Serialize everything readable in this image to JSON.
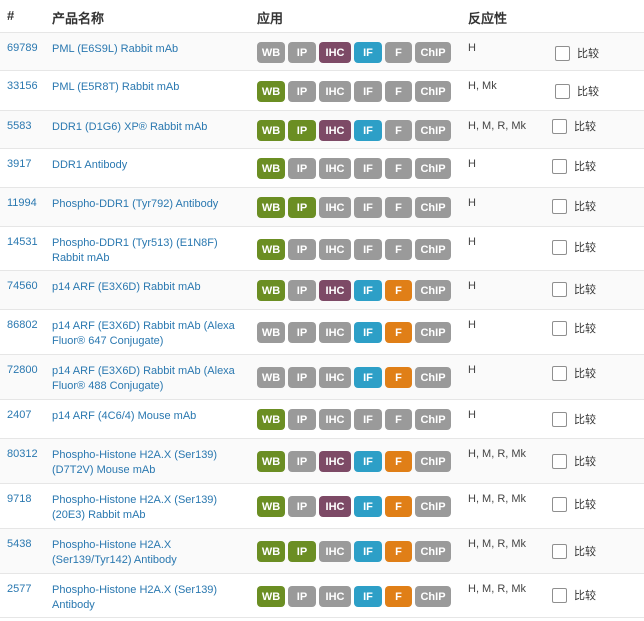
{
  "header": {
    "cat": "#",
    "name": "产品名称",
    "apps": "应用",
    "react": "反应性"
  },
  "colors": {
    "on": {
      "WB": "#6b8e23",
      "IP": "#6b8e23",
      "IHC": "#7d4a66",
      "IF": "#2d9fc7",
      "F": "#e07f17",
      "ChIP": "#9a9a9a"
    },
    "off": "#9a9a9a"
  },
  "rows": [
    {
      "cat": "69789",
      "name": "PML (E6S9L) Rabbit mAb",
      "apps": [
        [
          "WB",
          0
        ],
        [
          "IP",
          0
        ],
        [
          "IHC",
          1
        ],
        [
          "IF",
          1
        ],
        [
          "F",
          0
        ],
        [
          "ChIP",
          0
        ]
      ],
      "react": "H",
      "compare": "比较"
    },
    {
      "cat": "33156",
      "name": "PML (E5R8T) Rabbit mAb",
      "apps": [
        [
          "WB",
          1
        ],
        [
          "IP",
          0
        ],
        [
          "IHC",
          0
        ],
        [
          "IF",
          0
        ],
        [
          "F",
          0
        ],
        [
          "ChIP",
          0
        ]
      ],
      "react": "H, Mk",
      "compare": "比较"
    },
    {
      "cat": "5583",
      "name": "DDR1 (D1G6) XP® Rabbit mAb",
      "apps": [
        [
          "WB",
          1
        ],
        [
          "IP",
          1
        ],
        [
          "IHC",
          1
        ],
        [
          "IF",
          1
        ],
        [
          "F",
          0
        ],
        [
          "ChIP",
          0
        ]
      ],
      "react": "H, M, R, Mk",
      "compare": "比较"
    },
    {
      "cat": "3917",
      "name": "DDR1 Antibody",
      "apps": [
        [
          "WB",
          1
        ],
        [
          "IP",
          0
        ],
        [
          "IHC",
          0
        ],
        [
          "IF",
          0
        ],
        [
          "F",
          0
        ],
        [
          "ChIP",
          0
        ]
      ],
      "react": "H",
      "compare": "比较"
    },
    {
      "cat": "11994",
      "name": "Phospho-DDR1 (Tyr792) Antibody",
      "apps": [
        [
          "WB",
          1
        ],
        [
          "IP",
          1
        ],
        [
          "IHC",
          0
        ],
        [
          "IF",
          0
        ],
        [
          "F",
          0
        ],
        [
          "ChIP",
          0
        ]
      ],
      "react": "H",
      "compare": "比较"
    },
    {
      "cat": "14531",
      "name": "Phospho-DDR1 (Tyr513) (E1N8F) Rabbit mAb",
      "apps": [
        [
          "WB",
          1
        ],
        [
          "IP",
          0
        ],
        [
          "IHC",
          0
        ],
        [
          "IF",
          0
        ],
        [
          "F",
          0
        ],
        [
          "ChIP",
          0
        ]
      ],
      "react": "H",
      "compare": "比较"
    },
    {
      "cat": "74560",
      "name": "p14 ARF (E3X6D) Rabbit mAb",
      "apps": [
        [
          "WB",
          1
        ],
        [
          "IP",
          0
        ],
        [
          "IHC",
          1
        ],
        [
          "IF",
          1
        ],
        [
          "F",
          1
        ],
        [
          "ChIP",
          0
        ]
      ],
      "react": "H",
      "compare": "比较"
    },
    {
      "cat": "86802",
      "name": "p14 ARF (E3X6D) Rabbit mAb (Alexa Fluor® 647 Conjugate)",
      "apps": [
        [
          "WB",
          0
        ],
        [
          "IP",
          0
        ],
        [
          "IHC",
          0
        ],
        [
          "IF",
          1
        ],
        [
          "F",
          1
        ],
        [
          "ChIP",
          0
        ]
      ],
      "react": "H",
      "compare": "比较"
    },
    {
      "cat": "72800",
      "name": "p14 ARF (E3X6D) Rabbit mAb (Alexa Fluor® 488 Conjugate)",
      "apps": [
        [
          "WB",
          0
        ],
        [
          "IP",
          0
        ],
        [
          "IHC",
          0
        ],
        [
          "IF",
          1
        ],
        [
          "F",
          1
        ],
        [
          "ChIP",
          0
        ]
      ],
      "react": "H",
      "compare": "比较"
    },
    {
      "cat": "2407",
      "name": "p14 ARF (4C6/4) Mouse mAb",
      "apps": [
        [
          "WB",
          1
        ],
        [
          "IP",
          0
        ],
        [
          "IHC",
          0
        ],
        [
          "IF",
          0
        ],
        [
          "F",
          0
        ],
        [
          "ChIP",
          0
        ]
      ],
      "react": "H",
      "compare": "比较"
    },
    {
      "cat": "80312",
      "name": "Phospho-Histone H2A.X (Ser139) (D7T2V) Mouse mAb",
      "apps": [
        [
          "WB",
          1
        ],
        [
          "IP",
          0
        ],
        [
          "IHC",
          1
        ],
        [
          "IF",
          1
        ],
        [
          "F",
          1
        ],
        [
          "ChIP",
          0
        ]
      ],
      "react": "H, M, R, Mk",
      "compare": "比较"
    },
    {
      "cat": "9718",
      "name": "Phospho-Histone H2A.X (Ser139) (20E3) Rabbit mAb",
      "apps": [
        [
          "WB",
          1
        ],
        [
          "IP",
          0
        ],
        [
          "IHC",
          1
        ],
        [
          "IF",
          1
        ],
        [
          "F",
          1
        ],
        [
          "ChIP",
          0
        ]
      ],
      "react": "H, M, R, Mk",
      "compare": "比较"
    },
    {
      "cat": "5438",
      "name": "Phospho-Histone H2A.X (Ser139/Tyr142) Antibody",
      "apps": [
        [
          "WB",
          1
        ],
        [
          "IP",
          1
        ],
        [
          "IHC",
          0
        ],
        [
          "IF",
          1
        ],
        [
          "F",
          1
        ],
        [
          "ChIP",
          0
        ]
      ],
      "react": "H, M, R, Mk",
      "compare": "比较"
    },
    {
      "cat": "2577",
      "name": "Phospho-Histone H2A.X (Ser139) Antibody",
      "apps": [
        [
          "WB",
          1
        ],
        [
          "IP",
          0
        ],
        [
          "IHC",
          0
        ],
        [
          "IF",
          1
        ],
        [
          "F",
          1
        ],
        [
          "ChIP",
          0
        ]
      ],
      "react": "H, M, R, Mk",
      "compare": "比较"
    }
  ]
}
